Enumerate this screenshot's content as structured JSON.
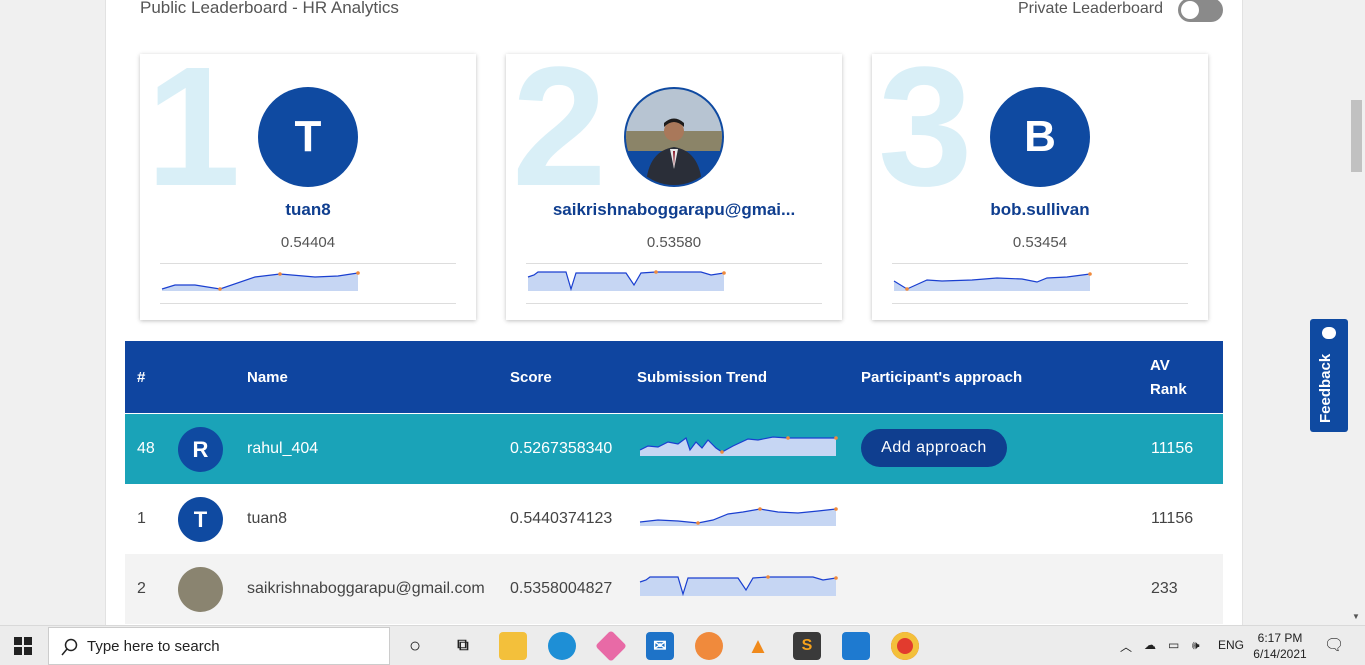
{
  "header": {
    "title": "Public Leaderboard - HR Analytics",
    "private_label": "Private Leaderboard"
  },
  "podium": [
    {
      "rank": "1",
      "initial": "T",
      "name": "tuan8",
      "score": "0.54404",
      "photo": false
    },
    {
      "rank": "2",
      "initial": "",
      "name": "saikrishnaboggarapu@gmai...",
      "score": "0.53580",
      "photo": true
    },
    {
      "rank": "3",
      "initial": "B",
      "name": "bob.sullivan",
      "score": "0.53454",
      "photo": false
    }
  ],
  "table": {
    "headers": {
      "rank": "#",
      "name": "Name",
      "score": "Score",
      "trend": "Submission Trend",
      "approach": "Participant's approach",
      "av_rank_1": "AV",
      "av_rank_2": "Rank"
    },
    "rows": [
      {
        "rank": "48",
        "initial": "R",
        "name": "rahul_404",
        "score": "0.5267358340",
        "approach": "Add approach",
        "av_rank": "11156",
        "highlight": true
      },
      {
        "rank": "1",
        "initial": "T",
        "name": "tuan8",
        "score": "0.5440374123",
        "approach": "",
        "av_rank": "11156",
        "highlight": false
      },
      {
        "rank": "2",
        "initial": "",
        "name": "saikrishnaboggarapu@gmail.com",
        "score": "0.5358004827",
        "approach": "",
        "av_rank": "233",
        "highlight": false
      }
    ]
  },
  "feedback": {
    "label": "Feedback"
  },
  "taskbar": {
    "search_placeholder": "Type here to search",
    "language": "ENG",
    "time": "6:17 PM",
    "date": "6/14/2021"
  },
  "colors": {
    "primary": "#0f45a0",
    "highlight_row": "#1aa3b8",
    "rank_watermark": "#d9eff7"
  }
}
